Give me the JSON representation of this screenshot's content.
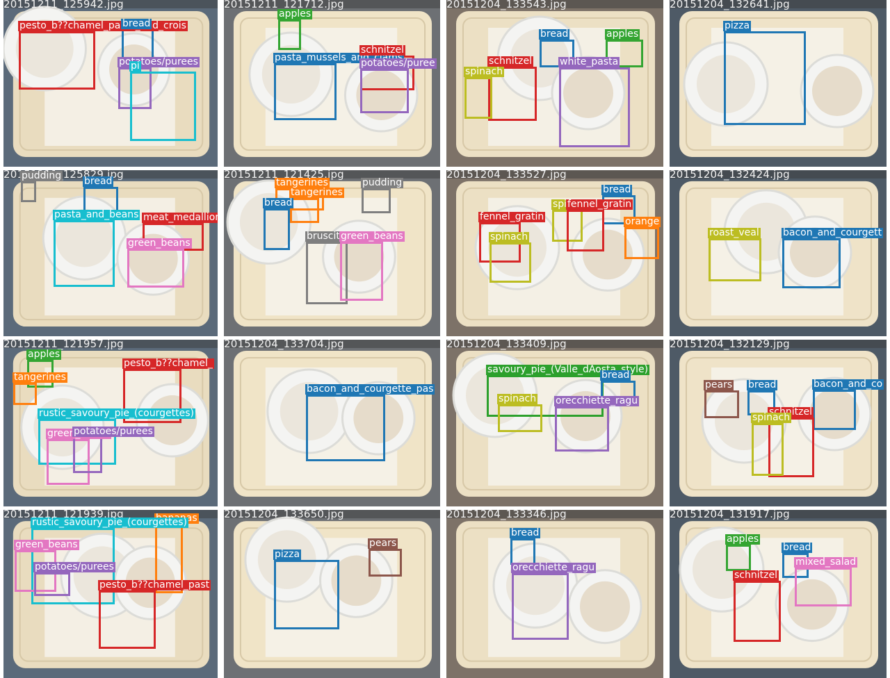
{
  "palette": {
    "apples": "#34a532",
    "bread": "#1f77b4",
    "pesto": "#d62728",
    "schnitzel": "#d62728",
    "meat": "#d62728",
    "pasta_mussels": "#1f77b4",
    "bacon": "#1f77b4",
    "pizza": "#1f77b4",
    "potatoes": "#9467bd",
    "white_pasta": "#9467bd",
    "orecchiette": "#9467bd",
    "spinach": "#bcbd22",
    "roast_veal": "#bcbd22",
    "fennel": "#d62728",
    "orange": "#ff7f0e",
    "tangerines": "#ff7f0e",
    "bananas": "#ff7f0e",
    "pudding": "#7f7f7f",
    "bruscitt": "#7f7f7f",
    "green_beans": "#e377c2",
    "mixed_salad": "#e377c2",
    "pears": "#8c564b",
    "pasta_and_beans": "#17becf",
    "rustic_pie": "#17becf",
    "savoury_pie": "#2ca02c"
  },
  "images": [
    {
      "filename": "20151211_125942.jpg",
      "detections": [
        {
          "label": "pesto_b??chamel_pasta_and_crois",
          "color": "pesto"
        },
        {
          "label": "bread",
          "color": "bread"
        },
        {
          "label": "potatoes/purees",
          "color": "potatoes"
        },
        {
          "label": "pi",
          "color": "rustic_pie"
        }
      ]
    },
    {
      "filename": "20151211_121712.jpg",
      "detections": [
        {
          "label": "apples",
          "color": "apples"
        },
        {
          "label": "pasta_mussels_and_clams",
          "color": "pasta_mussels"
        },
        {
          "label": "schnitzel",
          "color": "schnitzel"
        },
        {
          "label": "potatoes/puree",
          "color": "potatoes"
        }
      ]
    },
    {
      "filename": "20151204_133543.jpg",
      "detections": [
        {
          "label": "bread",
          "color": "bread"
        },
        {
          "label": "apples",
          "color": "apples"
        },
        {
          "label": "schnitzel",
          "color": "schnitzel"
        },
        {
          "label": "spinach",
          "color": "spinach"
        },
        {
          "label": "white_pasta",
          "color": "white_pasta"
        }
      ]
    },
    {
      "filename": "20151204_132641.jpg",
      "detections": [
        {
          "label": "pizza",
          "color": "pizza"
        }
      ]
    },
    {
      "filename": "20151211_125829.jpg",
      "detections": [
        {
          "label": "pudding",
          "color": "pudding"
        },
        {
          "label": "bread",
          "color": "bread"
        },
        {
          "label": "pasta_and_beans",
          "color": "pasta_and_beans"
        },
        {
          "label": "meat_medallion",
          "color": "meat"
        },
        {
          "label": "green_beans",
          "color": "green_beans"
        }
      ]
    },
    {
      "filename": "20151211_121425.jpg",
      "detections": [
        {
          "label": "tangerines",
          "color": "tangerines"
        },
        {
          "label": "tangerines",
          "color": "tangerines"
        },
        {
          "label": "pudding",
          "color": "pudding"
        },
        {
          "label": "bread",
          "color": "bread"
        },
        {
          "label": "bruscitt",
          "color": "bruscitt"
        },
        {
          "label": "green_beans",
          "color": "green_beans"
        }
      ]
    },
    {
      "filename": "20151204_133527.jpg",
      "detections": [
        {
          "label": "bread",
          "color": "bread"
        },
        {
          "label": "spinach",
          "color": "spinach"
        },
        {
          "label": "fennel_gratin",
          "color": "fennel"
        },
        {
          "label": "fennel_gratin",
          "color": "fennel"
        },
        {
          "label": "orange",
          "color": "orange"
        },
        {
          "label": "spinach",
          "color": "spinach"
        }
      ]
    },
    {
      "filename": "20151204_132424.jpg",
      "detections": [
        {
          "label": "roast_veal",
          "color": "roast_veal"
        },
        {
          "label": "bacon_and_courgett",
          "color": "bacon"
        }
      ]
    },
    {
      "filename": "20151211_121957.jpg",
      "detections": [
        {
          "label": "apples",
          "color": "apples"
        },
        {
          "label": "tangerines",
          "color": "tangerines"
        },
        {
          "label": "pesto_b??chamel_",
          "color": "pesto"
        },
        {
          "label": "rustic_savoury_pie_(courgettes)",
          "color": "rustic_pie"
        },
        {
          "label": "green_beans",
          "color": "green_beans"
        },
        {
          "label": "potatoes/purees",
          "color": "potatoes"
        }
      ]
    },
    {
      "filename": "20151204_133704.jpg",
      "detections": [
        {
          "label": "bacon_and_courgette_pas",
          "color": "bacon"
        }
      ]
    },
    {
      "filename": "20151204_133409.jpg",
      "detections": [
        {
          "label": "savoury_pie_(Valle_dAosta_style)",
          "color": "savoury_pie"
        },
        {
          "label": "bread",
          "color": "bread"
        },
        {
          "label": "spinach",
          "color": "spinach"
        },
        {
          "label": "orecchiette_ragu",
          "color": "orecchiette"
        }
      ]
    },
    {
      "filename": "20151204_132129.jpg",
      "detections": [
        {
          "label": "pears",
          "color": "pears"
        },
        {
          "label": "bread",
          "color": "bread"
        },
        {
          "label": "bacon_and_co",
          "color": "bacon"
        },
        {
          "label": "schnitzel",
          "color": "schnitzel"
        },
        {
          "label": "spinach",
          "color": "spinach"
        }
      ]
    },
    {
      "filename": "20151211_121939.jpg",
      "detections": [
        {
          "label": "bananas",
          "color": "bananas"
        },
        {
          "label": "rustic_savoury_pie_(courgettes)",
          "color": "rustic_pie"
        },
        {
          "label": "green_beans",
          "color": "green_beans"
        },
        {
          "label": "potatoes/purees",
          "color": "potatoes"
        },
        {
          "label": "pesto_b??chamel_past",
          "color": "pesto"
        }
      ]
    },
    {
      "filename": "20151204_133650.jpg",
      "detections": [
        {
          "label": "pizza",
          "color": "pizza"
        },
        {
          "label": "pears",
          "color": "pears"
        }
      ]
    },
    {
      "filename": "20151204_133346.jpg",
      "detections": [
        {
          "label": "bread",
          "color": "bread"
        },
        {
          "label": "orecchiette_ragu",
          "color": "orecchiette"
        }
      ]
    },
    {
      "filename": "20151204_131917.jpg",
      "detections": [
        {
          "label": "apples",
          "color": "apples"
        },
        {
          "label": "bread",
          "color": "bread"
        },
        {
          "label": "schnitzel",
          "color": "schnitzel"
        },
        {
          "label": "mixed_salad",
          "color": "mixed_salad"
        }
      ]
    }
  ]
}
